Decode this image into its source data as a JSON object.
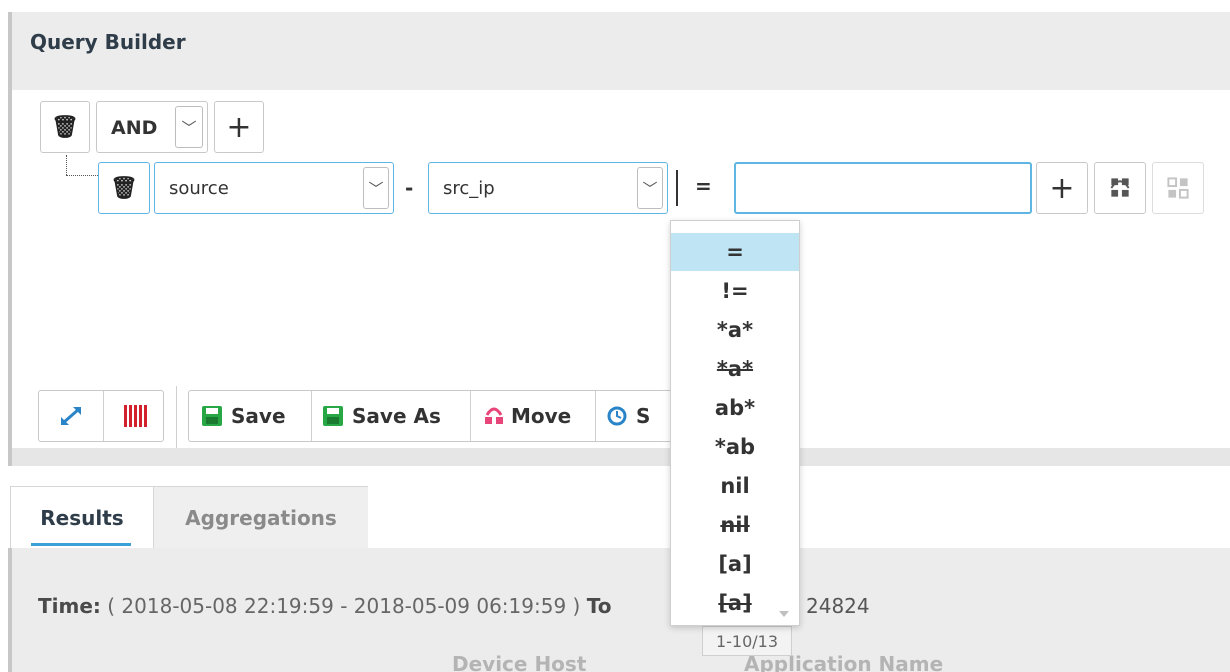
{
  "panel": {
    "title": "Query Builder"
  },
  "group": {
    "operator": "AND"
  },
  "rule": {
    "field": "source",
    "subfield": "src_ip",
    "dash": "-",
    "operator": "=",
    "value": ""
  },
  "operator_options": [
    "=",
    "!=",
    "*a*",
    "*a*",
    "ab*",
    "*ab",
    "nil",
    "nil",
    "[a]",
    "[a]"
  ],
  "operator_options_struck": [
    false,
    false,
    false,
    true,
    false,
    false,
    false,
    true,
    false,
    true
  ],
  "pagination": "1-10/13",
  "toolbar": {
    "save_label": "Save",
    "save_as_label": "Save As",
    "move_label": "Move",
    "next_label_partial": "S"
  },
  "tabs": {
    "results": "Results",
    "aggregations": "Aggregations"
  },
  "results": {
    "time_label": "Time:",
    "time_range": "( 2018-05-08 22:19:59 - 2018-05-09 06:19:59 )",
    "total_label": "To",
    "total_value": "24824",
    "col_headers": [
      "Device Host",
      "Application Name"
    ]
  },
  "icons": [
    "trash-icon",
    "chevron-down-icon",
    "plus-icon",
    "group-icon",
    "ungroup-icon",
    "expand-icon",
    "columns-icon",
    "save-icon",
    "move-icon",
    "refresh-icon"
  ],
  "colors": {
    "accent": "#3aa0d8",
    "selected_option": "#bfe4f4",
    "save_green": "#27a844",
    "move_pink": "#e8457a",
    "columns_red": "#d3202f",
    "expand_blue": "#2a84c8"
  }
}
